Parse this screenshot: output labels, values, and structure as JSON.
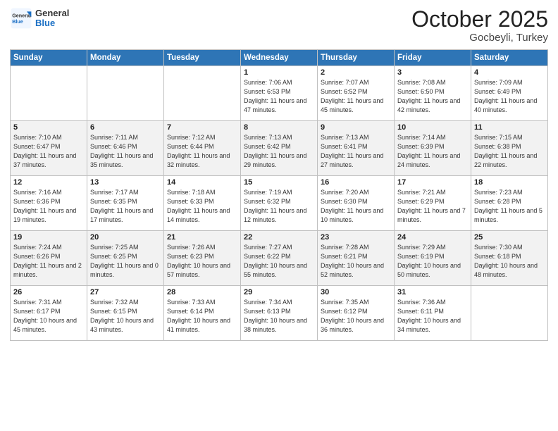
{
  "header": {
    "logo_general": "General",
    "logo_blue": "Blue",
    "month_title": "October 2025",
    "location": "Gocbeyli, Turkey"
  },
  "days_of_week": [
    "Sunday",
    "Monday",
    "Tuesday",
    "Wednesday",
    "Thursday",
    "Friday",
    "Saturday"
  ],
  "weeks": [
    [
      {
        "day": "",
        "info": ""
      },
      {
        "day": "",
        "info": ""
      },
      {
        "day": "",
        "info": ""
      },
      {
        "day": "1",
        "info": "Sunrise: 7:06 AM\nSunset: 6:53 PM\nDaylight: 11 hours\nand 47 minutes."
      },
      {
        "day": "2",
        "info": "Sunrise: 7:07 AM\nSunset: 6:52 PM\nDaylight: 11 hours\nand 45 minutes."
      },
      {
        "day": "3",
        "info": "Sunrise: 7:08 AM\nSunset: 6:50 PM\nDaylight: 11 hours\nand 42 minutes."
      },
      {
        "day": "4",
        "info": "Sunrise: 7:09 AM\nSunset: 6:49 PM\nDaylight: 11 hours\nand 40 minutes."
      }
    ],
    [
      {
        "day": "5",
        "info": "Sunrise: 7:10 AM\nSunset: 6:47 PM\nDaylight: 11 hours\nand 37 minutes."
      },
      {
        "day": "6",
        "info": "Sunrise: 7:11 AM\nSunset: 6:46 PM\nDaylight: 11 hours\nand 35 minutes."
      },
      {
        "day": "7",
        "info": "Sunrise: 7:12 AM\nSunset: 6:44 PM\nDaylight: 11 hours\nand 32 minutes."
      },
      {
        "day": "8",
        "info": "Sunrise: 7:13 AM\nSunset: 6:42 PM\nDaylight: 11 hours\nand 29 minutes."
      },
      {
        "day": "9",
        "info": "Sunrise: 7:13 AM\nSunset: 6:41 PM\nDaylight: 11 hours\nand 27 minutes."
      },
      {
        "day": "10",
        "info": "Sunrise: 7:14 AM\nSunset: 6:39 PM\nDaylight: 11 hours\nand 24 minutes."
      },
      {
        "day": "11",
        "info": "Sunrise: 7:15 AM\nSunset: 6:38 PM\nDaylight: 11 hours\nand 22 minutes."
      }
    ],
    [
      {
        "day": "12",
        "info": "Sunrise: 7:16 AM\nSunset: 6:36 PM\nDaylight: 11 hours\nand 19 minutes."
      },
      {
        "day": "13",
        "info": "Sunrise: 7:17 AM\nSunset: 6:35 PM\nDaylight: 11 hours\nand 17 minutes."
      },
      {
        "day": "14",
        "info": "Sunrise: 7:18 AM\nSunset: 6:33 PM\nDaylight: 11 hours\nand 14 minutes."
      },
      {
        "day": "15",
        "info": "Sunrise: 7:19 AM\nSunset: 6:32 PM\nDaylight: 11 hours\nand 12 minutes."
      },
      {
        "day": "16",
        "info": "Sunrise: 7:20 AM\nSunset: 6:30 PM\nDaylight: 11 hours\nand 10 minutes."
      },
      {
        "day": "17",
        "info": "Sunrise: 7:21 AM\nSunset: 6:29 PM\nDaylight: 11 hours\nand 7 minutes."
      },
      {
        "day": "18",
        "info": "Sunrise: 7:23 AM\nSunset: 6:28 PM\nDaylight: 11 hours\nand 5 minutes."
      }
    ],
    [
      {
        "day": "19",
        "info": "Sunrise: 7:24 AM\nSunset: 6:26 PM\nDaylight: 11 hours\nand 2 minutes."
      },
      {
        "day": "20",
        "info": "Sunrise: 7:25 AM\nSunset: 6:25 PM\nDaylight: 11 hours\nand 0 minutes."
      },
      {
        "day": "21",
        "info": "Sunrise: 7:26 AM\nSunset: 6:23 PM\nDaylight: 10 hours\nand 57 minutes."
      },
      {
        "day": "22",
        "info": "Sunrise: 7:27 AM\nSunset: 6:22 PM\nDaylight: 10 hours\nand 55 minutes."
      },
      {
        "day": "23",
        "info": "Sunrise: 7:28 AM\nSunset: 6:21 PM\nDaylight: 10 hours\nand 52 minutes."
      },
      {
        "day": "24",
        "info": "Sunrise: 7:29 AM\nSunset: 6:19 PM\nDaylight: 10 hours\nand 50 minutes."
      },
      {
        "day": "25",
        "info": "Sunrise: 7:30 AM\nSunset: 6:18 PM\nDaylight: 10 hours\nand 48 minutes."
      }
    ],
    [
      {
        "day": "26",
        "info": "Sunrise: 7:31 AM\nSunset: 6:17 PM\nDaylight: 10 hours\nand 45 minutes."
      },
      {
        "day": "27",
        "info": "Sunrise: 7:32 AM\nSunset: 6:15 PM\nDaylight: 10 hours\nand 43 minutes."
      },
      {
        "day": "28",
        "info": "Sunrise: 7:33 AM\nSunset: 6:14 PM\nDaylight: 10 hours\nand 41 minutes."
      },
      {
        "day": "29",
        "info": "Sunrise: 7:34 AM\nSunset: 6:13 PM\nDaylight: 10 hours\nand 38 minutes."
      },
      {
        "day": "30",
        "info": "Sunrise: 7:35 AM\nSunset: 6:12 PM\nDaylight: 10 hours\nand 36 minutes."
      },
      {
        "day": "31",
        "info": "Sunrise: 7:36 AM\nSunset: 6:11 PM\nDaylight: 10 hours\nand 34 minutes."
      },
      {
        "day": "",
        "info": ""
      }
    ]
  ]
}
